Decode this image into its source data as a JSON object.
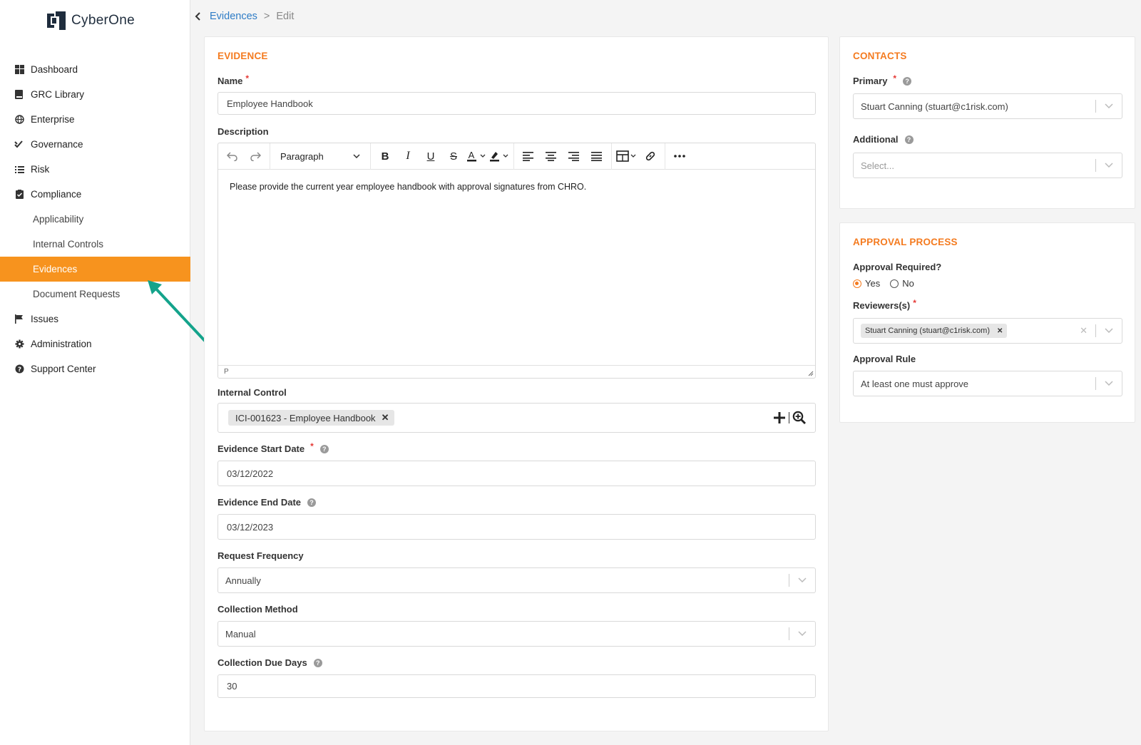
{
  "brand": {
    "name": "CyberOne",
    "accent": "#f7931e"
  },
  "sidebar": {
    "items": [
      {
        "label": "Dashboard",
        "icon": "dashboard-icon"
      },
      {
        "label": "GRC Library",
        "icon": "book-icon"
      },
      {
        "label": "Enterprise",
        "icon": "globe-icon"
      },
      {
        "label": "Governance",
        "icon": "check-double-icon"
      },
      {
        "label": "Risk",
        "icon": "list-icon"
      },
      {
        "label": "Compliance",
        "icon": "clipboard-check-icon"
      },
      {
        "label": "Applicability"
      },
      {
        "label": "Internal Controls"
      },
      {
        "label": "Evidences",
        "active": true
      },
      {
        "label": "Document Requests"
      },
      {
        "label": "Issues",
        "icon": "flag-icon"
      },
      {
        "label": "Administration",
        "icon": "gear-icon"
      },
      {
        "label": "Support Center",
        "icon": "question-circle-icon"
      }
    ]
  },
  "breadcrumb": {
    "parent": "Evidences",
    "separator": ">",
    "current": "Edit"
  },
  "evidence": {
    "section_title": "EVIDENCE",
    "name_label": "Name",
    "name_value": "Employee Handbook",
    "description_label": "Description",
    "editor": {
      "block_format": "Paragraph",
      "content": "Please provide the current year employee handbook with approval signatures from CHRO.",
      "status_path": "P"
    },
    "internal_control_label": "Internal Control",
    "internal_control_chip": "ICI-001623 - Employee Handbook",
    "start_date_label": "Evidence Start Date",
    "start_date_value": "03/12/2022",
    "end_date_label": "Evidence End Date",
    "end_date_value": "03/12/2023",
    "frequency_label": "Request Frequency",
    "frequency_value": "Annually",
    "collection_method_label": "Collection Method",
    "collection_method_value": "Manual",
    "due_days_label": "Collection Due Days",
    "due_days_value": "30"
  },
  "contacts": {
    "section_title": "CONTACTS",
    "primary_label": "Primary",
    "primary_value": "Stuart Canning (stuart@c1risk.com)",
    "additional_label": "Additional",
    "additional_placeholder": "Select..."
  },
  "approval": {
    "section_title": "APPROVAL PROCESS",
    "required_label": "Approval Required?",
    "yes_label": "Yes",
    "no_label": "No",
    "selected": "Yes",
    "reviewers_label": "Reviewers(s)",
    "reviewer_chip": "Stuart Canning (stuart@c1risk.com)",
    "rule_label": "Approval Rule",
    "rule_value": "At least one must approve"
  }
}
